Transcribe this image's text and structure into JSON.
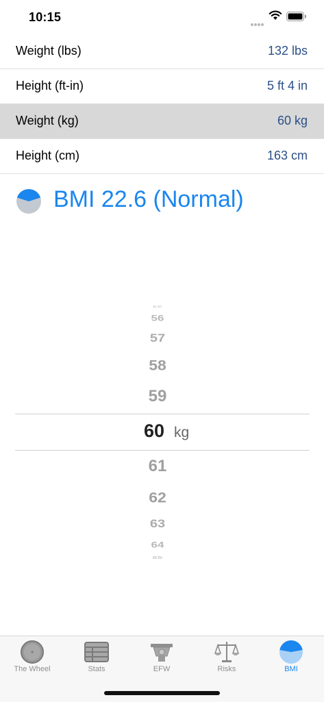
{
  "status_bar": {
    "time": "10:15"
  },
  "rows": [
    {
      "label": "Weight (lbs)",
      "value": "132 lbs",
      "selected": false
    },
    {
      "label": "Height (ft-in)",
      "value": "5 ft 4 in",
      "selected": false
    },
    {
      "label": "Weight (kg)",
      "value": "60 kg",
      "selected": true
    },
    {
      "label": "Height (cm)",
      "value": "163 cm",
      "selected": false
    }
  ],
  "bmi": {
    "text": "BMI 22.6 (Normal)",
    "icon": "bmi-pie-icon",
    "color": "#1a86ee"
  },
  "picker": {
    "above": [
      "55",
      "56",
      "57",
      "58",
      "59"
    ],
    "selected": "60",
    "unit": "kg",
    "below": [
      "61",
      "62",
      "63",
      "64",
      "65"
    ]
  },
  "tab_bar": {
    "tabs": [
      {
        "label": "The Wheel",
        "icon": "wheel-icon",
        "active": false
      },
      {
        "label": "Stats",
        "icon": "stats-icon",
        "active": false
      },
      {
        "label": "EFW",
        "icon": "scale-icon",
        "active": false
      },
      {
        "label": "Risks",
        "icon": "balance-icon",
        "active": false
      },
      {
        "label": "BMI",
        "icon": "bmi-pie-icon",
        "active": true
      }
    ]
  },
  "colors": {
    "accent": "#1a86ee",
    "value_text": "#2b4f88",
    "selected_row": "#d8d8d8"
  }
}
